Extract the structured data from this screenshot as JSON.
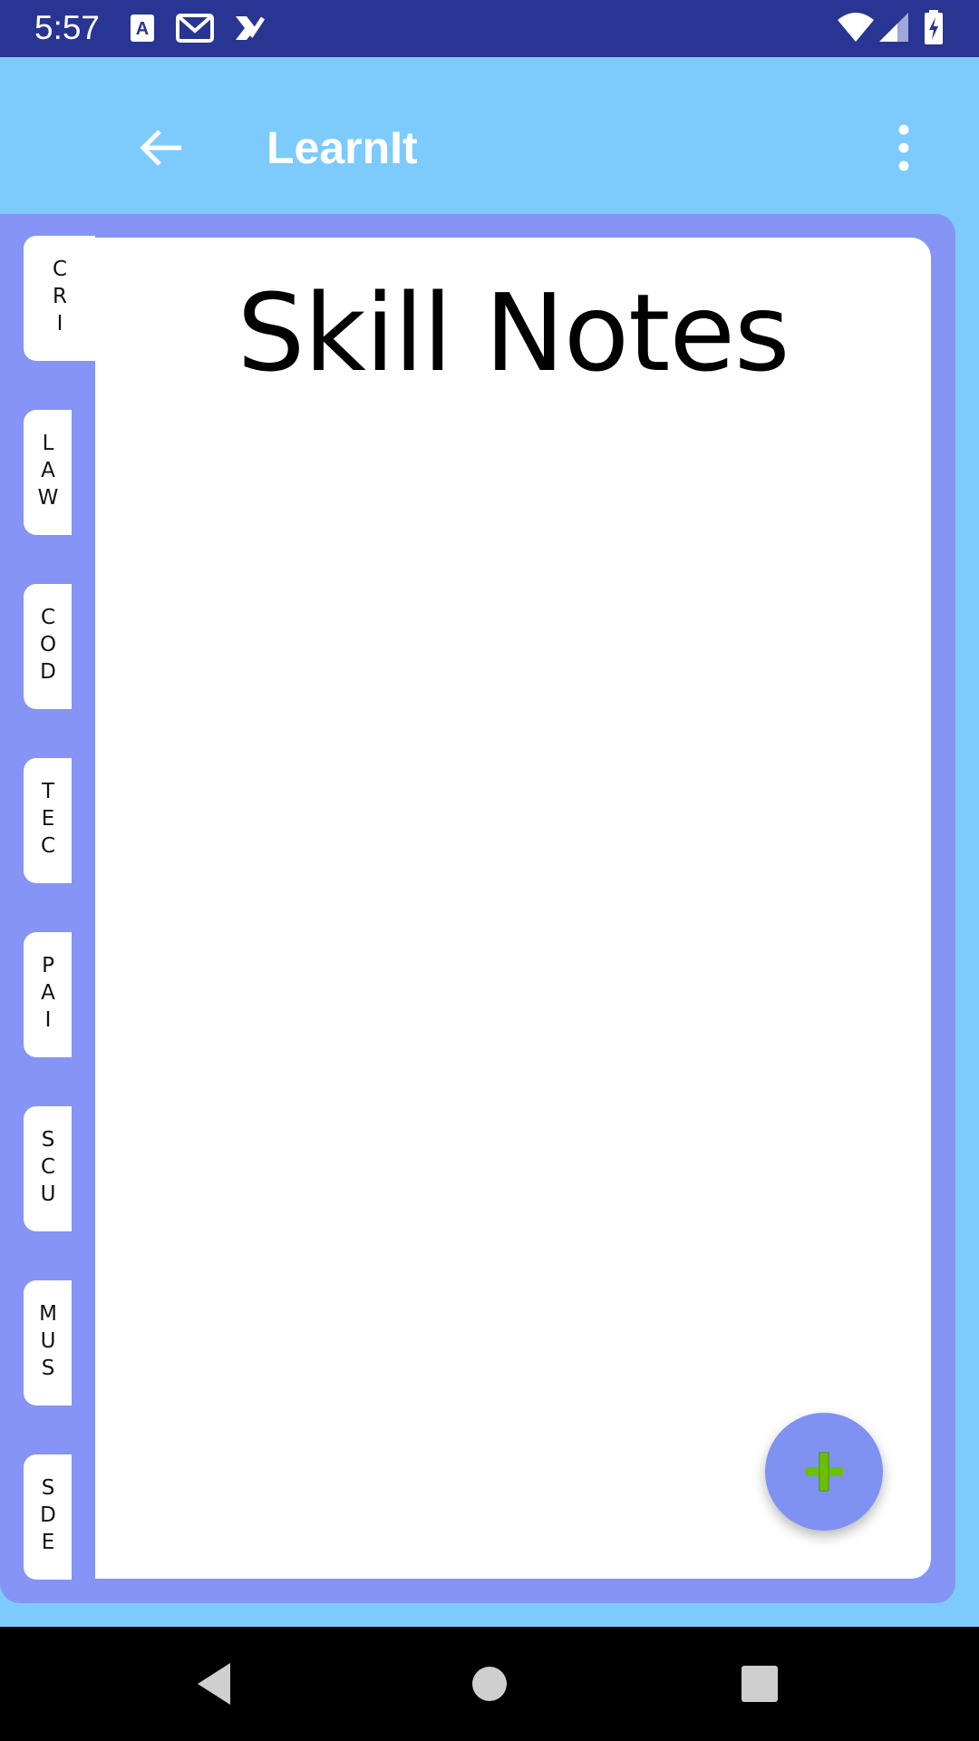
{
  "status_bar": {
    "time": "5:57",
    "icons": [
      "translate-a-icon",
      "gmail-icon",
      "tasks-check-icon",
      "wifi-icon",
      "cell-signal-icon",
      "battery-charging-icon"
    ]
  },
  "app_bar": {
    "title": "LearnIt",
    "back_icon": "arrow-back-icon",
    "menu_icon": "more-vert-icon"
  },
  "notebook": {
    "title": "Skill Notes",
    "active_tab": "CRI",
    "tabs": [
      {
        "label": "CRI"
      },
      {
        "label": "LAW"
      },
      {
        "label": "COD"
      },
      {
        "label": "TEC"
      },
      {
        "label": "PAI"
      },
      {
        "label": "SCU"
      },
      {
        "label": "MUS"
      },
      {
        "label": "SDE"
      }
    ]
  },
  "fab": {
    "icon": "plus-icon",
    "accent": "#7f92f1",
    "icon_color": "#6cc000"
  },
  "nav_bar": {
    "icons": [
      "back-triangle-icon",
      "home-circle-icon",
      "recents-square-icon"
    ]
  },
  "colors": {
    "status_bar": "#283593",
    "app_background": "#7ccbfc",
    "notebook_frame": "#8594f5",
    "page": "#ffffff"
  }
}
